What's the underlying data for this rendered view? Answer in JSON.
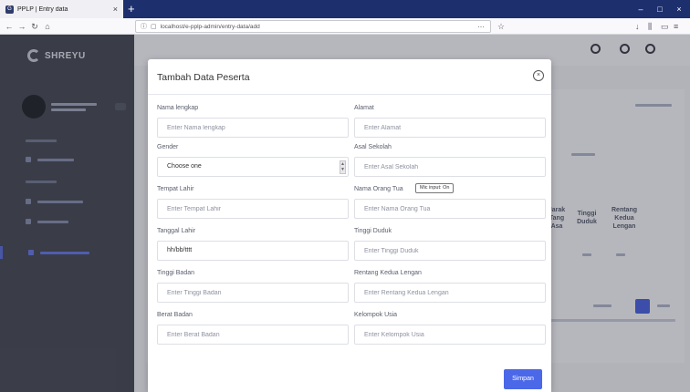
{
  "browser": {
    "tab_title": "PPLP | Entry data",
    "tab_close": "×",
    "new_tab": "+",
    "url": "localhost/e-pplp-admin/entry-data/add",
    "url_scheme_icon": "info-icon",
    "page_actions": "⋯",
    "window_controls": [
      "–",
      "□",
      "×"
    ]
  },
  "app": {
    "brand": "SHREYU"
  },
  "modal": {
    "title": "Tambah Data Peserta",
    "close_icon": "×",
    "fields_left": [
      {
        "label": "Nama lengkap",
        "placeholder": "Enter Nama lengkap",
        "kind": "text"
      },
      {
        "label": "Gender",
        "value": "Choose one",
        "kind": "select"
      },
      {
        "label": "Tempat Lahir",
        "placeholder": "Enter Tempat Lahir",
        "kind": "text"
      },
      {
        "label": "Tanggal Lahir",
        "value": "hh/bb/tttt",
        "kind": "date"
      },
      {
        "label": "Tinggi Badan",
        "placeholder": "Enter Tinggi Badan",
        "kind": "text"
      },
      {
        "label": "Berat Badan",
        "placeholder": "Enter Berat Badan",
        "kind": "text"
      }
    ],
    "fields_right": [
      {
        "label": "Alamat",
        "placeholder": "Enter Alamat",
        "kind": "text"
      },
      {
        "label": "Asal Sekolah",
        "placeholder": "Enter Asal Sekolah",
        "kind": "text"
      },
      {
        "label": "Nama Orang Tua",
        "placeholder": "Enter Nama Orang Tua",
        "kind": "text"
      },
      {
        "label": "Tinggi Duduk",
        "placeholder": "Enter Tinggi Duduk",
        "kind": "text"
      },
      {
        "label": "Rentang Kedua Lengan",
        "placeholder": "Enter Rentang Kedua Lengan",
        "kind": "text"
      },
      {
        "label": "Kelompok Usia",
        "placeholder": "Enter Kelompok Usia",
        "kind": "text"
      }
    ],
    "mic_badge": "Mic input: On",
    "save_label": "Simpan"
  },
  "background_table": {
    "headers": [
      "Jarak Tang Asa",
      "Tinggi Duduk",
      "Rentang Kedua Lengan"
    ]
  },
  "colors": {
    "tabbar": "#1e2f6e",
    "sidebar": "#3a3c47",
    "accent": "#4b68e8"
  }
}
